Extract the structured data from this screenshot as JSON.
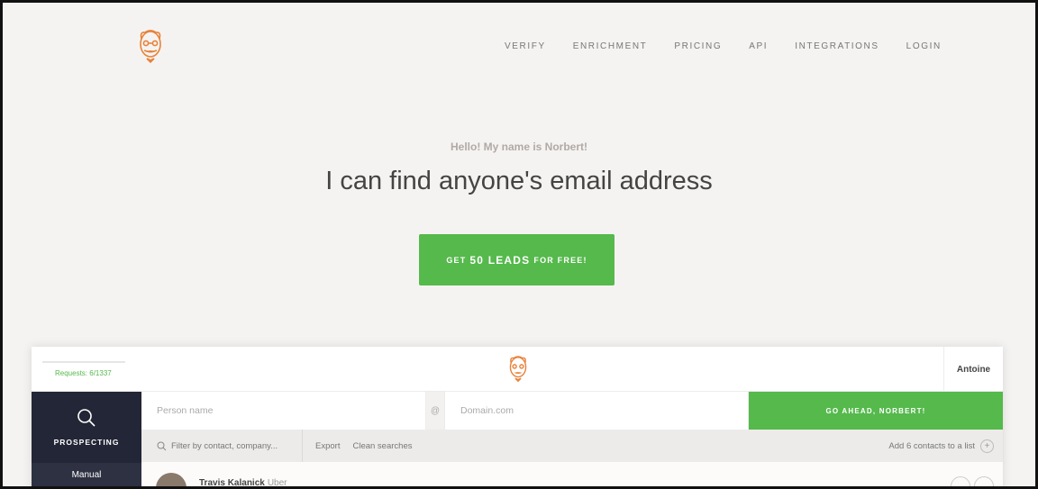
{
  "nav": {
    "items": [
      "VERIFY",
      "ENRICHMENT",
      "PRICING",
      "API",
      "INTEGRATIONS",
      "LOGIN"
    ]
  },
  "hero": {
    "greeting": "Hello! My name is Norbert!",
    "headline": "I can find anyone's email address",
    "cta_prefix": "GET",
    "cta_main": "50 LEADS",
    "cta_suffix": "FOR FREE!"
  },
  "app": {
    "requests": "Requests: 6/1337",
    "user": "Antoine",
    "sidebar": {
      "prospecting": "PROSPECTING",
      "manual": "Manual"
    },
    "search": {
      "person_placeholder": "Person name",
      "at": "@",
      "domain_placeholder": "Domain.com",
      "go_button": "GO AHEAD, NORBERT!"
    },
    "toolbar": {
      "filter_placeholder": "Filter by contact, company...",
      "export": "Export",
      "clean": "Clean searches",
      "add_to_list": "Add 6 contacts to a list"
    },
    "rows": [
      {
        "name": "Travis Kalanick",
        "company": "Uber"
      }
    ]
  },
  "colors": {
    "accent_green": "#55b94c",
    "logo_orange": "#e8823a",
    "sidebar_dark": "#232636"
  }
}
